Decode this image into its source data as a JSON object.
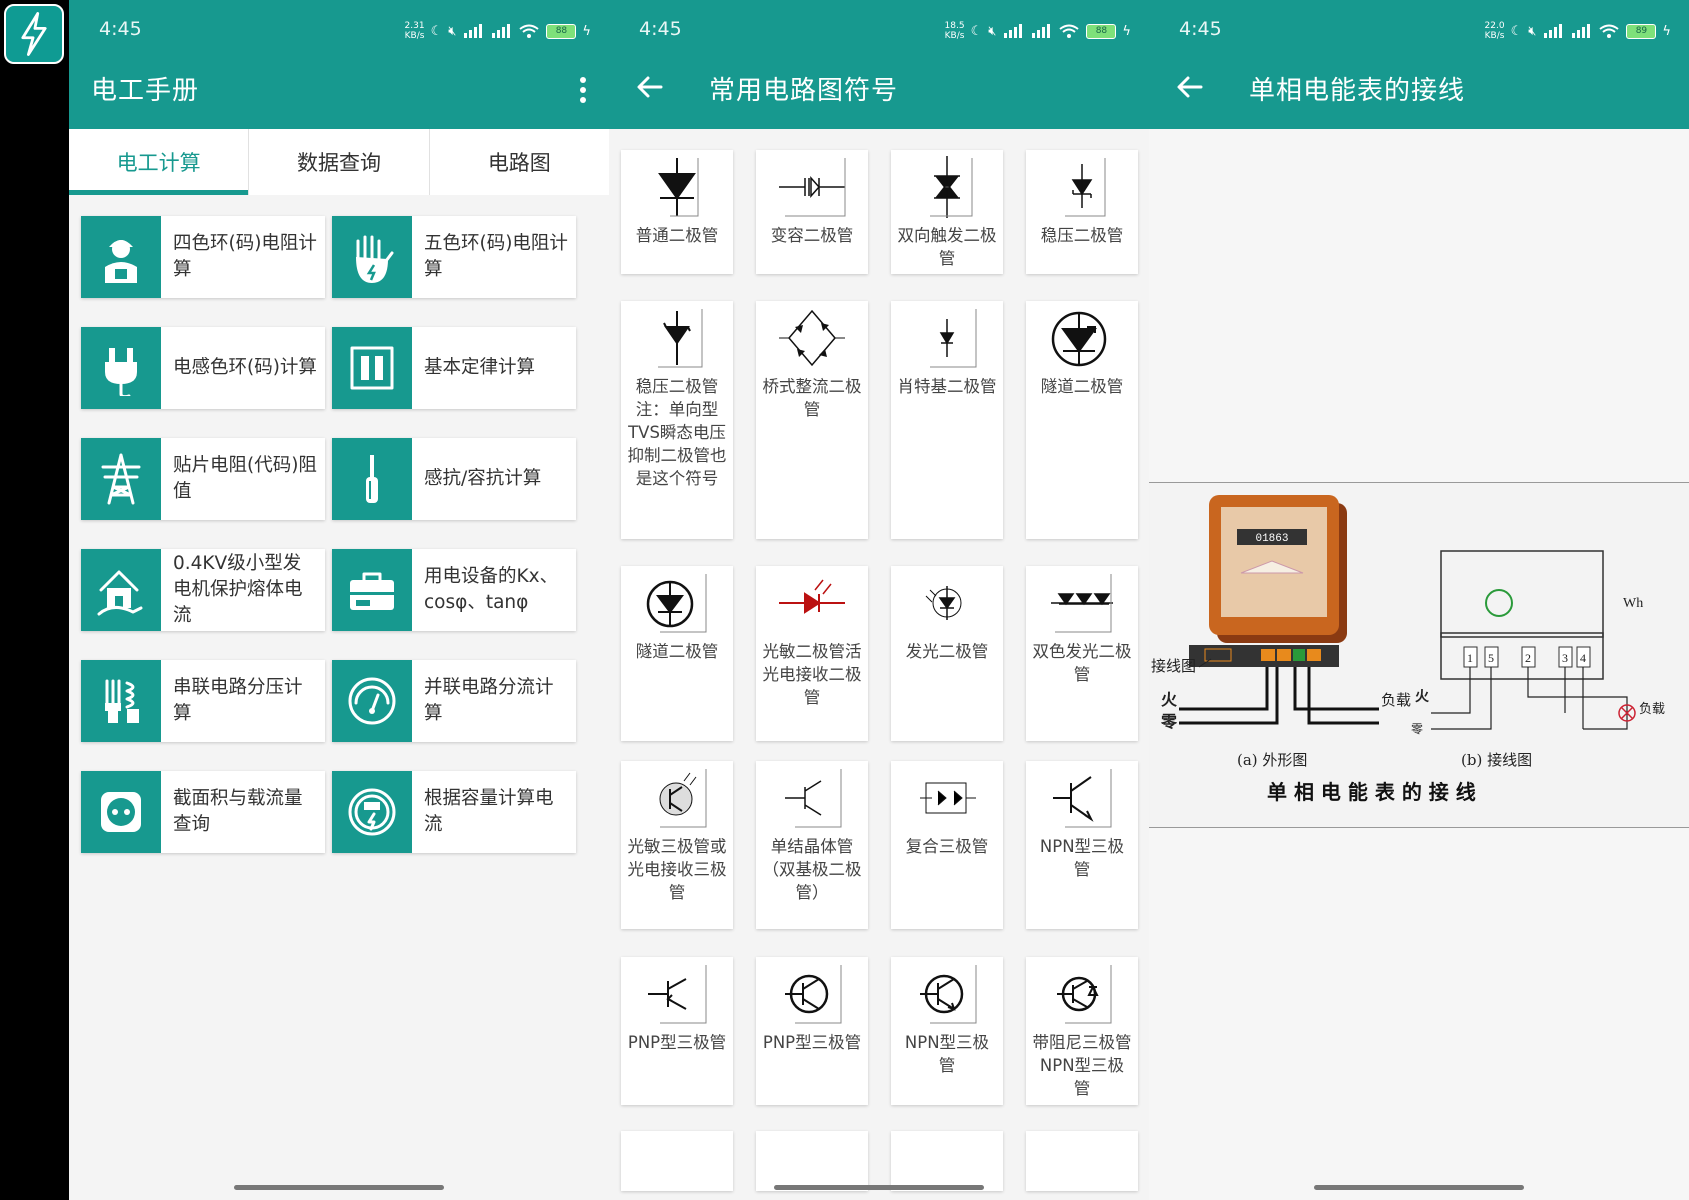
{
  "status": {
    "time": "4:45",
    "screens": [
      {
        "speed": "2.31\nKB/s",
        "battery": "88"
      },
      {
        "speed": "18.5\nKB/s",
        "battery": "88"
      },
      {
        "speed": "22.0\nKB/s",
        "battery": "89"
      }
    ]
  },
  "screen1": {
    "title": "电工手册",
    "tabs": [
      "电工计算",
      "数据查询",
      "电路图"
    ],
    "active_tab": 0,
    "items": [
      {
        "label": "四色环(码)电阻计算",
        "icon": "worker-icon"
      },
      {
        "label": "五色环(码)电阻计算",
        "icon": "glove-icon"
      },
      {
        "label": "电感色环(码)计算",
        "icon": "plug-icon"
      },
      {
        "label": "基本定律计算",
        "icon": "switch-icon"
      },
      {
        "label": "贴片电阻(代码)阻值",
        "icon": "power-tower-icon"
      },
      {
        "label": "感抗/容抗计算",
        "icon": "screwdriver-icon"
      },
      {
        "label": "0.4KV级小型发电机保护熔体电流",
        "icon": "house-plug-icon"
      },
      {
        "label": "用电设备的Kx、cosφ、tanφ",
        "icon": "toolbox-icon"
      },
      {
        "label": "串联电路分压计算",
        "icon": "bulbs-icon"
      },
      {
        "label": "并联电路分流计算",
        "icon": "meter-gauge-icon"
      },
      {
        "label": "截面积与载流量查询",
        "icon": "socket-icon"
      },
      {
        "label": "根据容量计算电流",
        "icon": "electric-meter-icon"
      }
    ]
  },
  "screen2": {
    "title": "常用电路图符号",
    "symbols": [
      {
        "label": "普通二极管",
        "icon": "diode-icon"
      },
      {
        "label": "变容二极管",
        "icon": "varactor-diode-icon"
      },
      {
        "label": "双向触发二极管",
        "icon": "diac-icon"
      },
      {
        "label": "稳压二极管",
        "icon": "zener-diode-icon"
      },
      {
        "label": "稳压二极管 注：单向型TVS瞬态电压抑制二极管也是这个符号",
        "icon": "zener-tvs-icon"
      },
      {
        "label": "桥式整流二极管",
        "icon": "bridge-rectifier-icon"
      },
      {
        "label": "肖特基二极管",
        "icon": "schottky-diode-icon"
      },
      {
        "label": "隧道二极管",
        "icon": "tunnel-diode-icon"
      },
      {
        "label": "隧道二极管",
        "icon": "tunnel-diode-alt-icon"
      },
      {
        "label": "光敏二极管活光电接收二极管",
        "icon": "photodiode-icon"
      },
      {
        "label": "发光二极管",
        "icon": "led-icon"
      },
      {
        "label": "双色发光二极管",
        "icon": "bicolor-led-icon"
      },
      {
        "label": "光敏三极管或光电接收三极管",
        "icon": "phototransistor-icon"
      },
      {
        "label": "单结晶体管（双基极二极管）",
        "icon": "ujt-icon"
      },
      {
        "label": "复合三极管",
        "icon": "darlington-icon"
      },
      {
        "label": "NPN型三极管",
        "icon": "npn-transistor-icon"
      },
      {
        "label": "PNP型三极管",
        "icon": "pnp-transistor-icon"
      },
      {
        "label": "PNP型三极管",
        "icon": "pnp-circle-transistor-icon"
      },
      {
        "label": "NPN型三极管",
        "icon": "npn-circle-transistor-icon"
      },
      {
        "label": "带阻尼三极管NPN型三极管",
        "icon": "damped-npn-icon"
      }
    ]
  },
  "screen3": {
    "title": "单相电能表的接线",
    "diagram": {
      "counter": "01863",
      "label_wiring": "接线图",
      "label_live": "火",
      "label_neutral": "零",
      "label_load": "负载",
      "label_live2": "火",
      "label_neutral2": "零",
      "label_load2": "负载",
      "label_wh": "Wh",
      "terminals": [
        "1",
        "5",
        "2",
        "3",
        "4"
      ],
      "caption_a": "(a) 外形图",
      "caption_b": "(b) 接线图",
      "caption_main": "单 相 电 能 表 的 接 线"
    }
  },
  "colors": {
    "accent": "#17998f",
    "background": "#f4f4f4"
  }
}
